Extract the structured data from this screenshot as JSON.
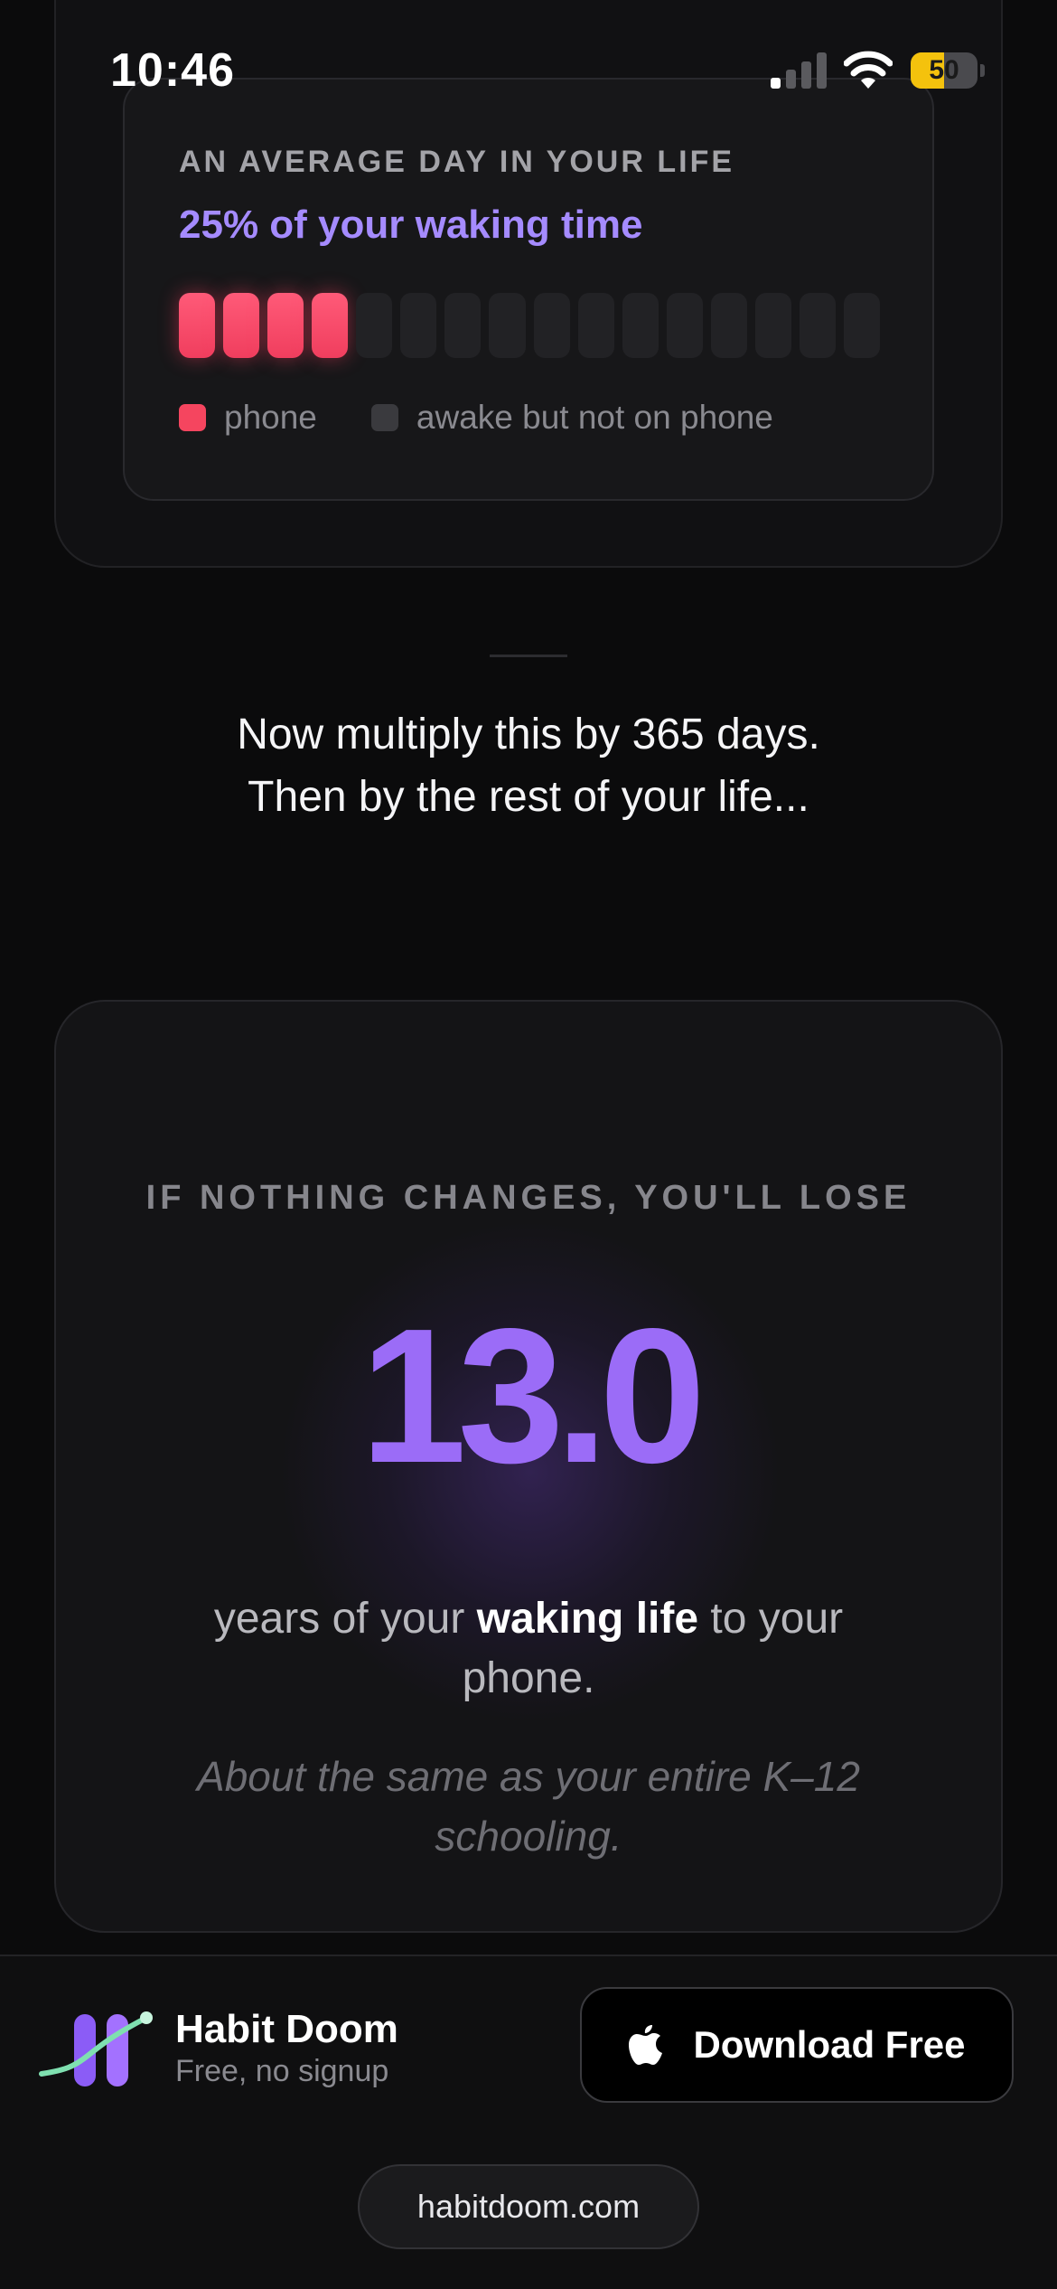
{
  "status_bar": {
    "time": "10:46",
    "battery_level": "50",
    "battery_fraction": 0.5,
    "battery_color": "#f4c20d",
    "signal_bars_active": 1,
    "signal_bars_total": 4
  },
  "day_card": {
    "label": "AN AVERAGE DAY IN YOUR LIFE",
    "percent_text": "25% of your waking time",
    "segments_total": 16,
    "segments_phone": 4,
    "legend": [
      {
        "label": "phone",
        "color": "#f5455f"
      },
      {
        "label": "awake but not on phone",
        "color": "#3a3a3e"
      }
    ]
  },
  "multiply_text": {
    "line1": "Now multiply this by 365 days.",
    "line2": "Then by the rest of your life..."
  },
  "loss_card": {
    "label": "IF NOTHING CHANGES, YOU'LL LOSE",
    "number": "13.0",
    "years_prefix": "years of your ",
    "years_bold": "waking life",
    "years_suffix": " to your phone.",
    "comparison": "About the same as your entire K–12 schooling.",
    "accent_color": "#9b6cf7"
  },
  "bottom_bar": {
    "app_name": "Habit Doom",
    "app_subtitle": "Free, no signup",
    "download_label": "Download Free",
    "site": "habitdoom.com",
    "icons": [
      "habit-doom-logo",
      "apple-icon"
    ]
  }
}
